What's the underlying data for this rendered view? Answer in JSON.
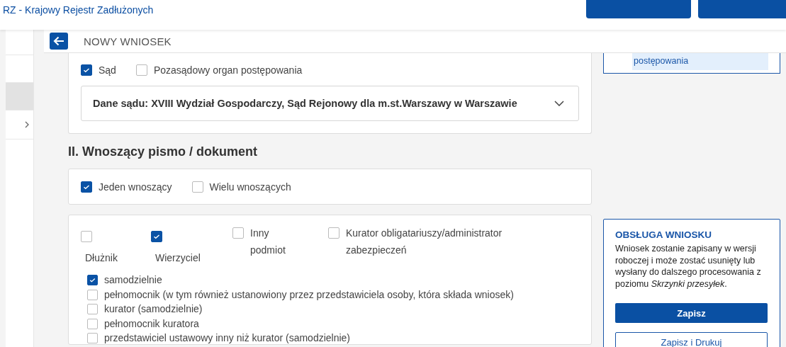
{
  "app_title": "RZ - Krajowy Rejestr Zadłużonych",
  "sidebar": {
    "items": [
      {
        "selected": false,
        "expandable": false
      },
      {
        "selected": true,
        "expandable": false
      },
      {
        "selected": false,
        "expandable": true
      }
    ]
  },
  "page_title": "NOWY WNIOSEK",
  "court_type_options": [
    {
      "label": "Sąd",
      "checked": true
    },
    {
      "label": "Pozasądowy organ postępowania",
      "checked": false
    }
  ],
  "court_select": {
    "value": "Dane sądu: XVIII Wydział Gospodarczy, Sąd Rejonowy dla m.st.Warszawy w Warszawie"
  },
  "section_heading": "II. Wnoszący pismo / dokument",
  "filer_count_options": [
    {
      "label": "Jeden wnoszący",
      "checked": true
    },
    {
      "label": "Wielu wnoszących",
      "checked": false
    }
  ],
  "filer_roles": [
    {
      "label": "Dłużnik",
      "checked": false
    },
    {
      "label": "Wierzyciel",
      "checked": true
    },
    {
      "label": "Inny podmiot",
      "checked": false
    },
    {
      "label": "Kurator obligatariuszy/administrator zabezpieczeń",
      "checked": false
    }
  ],
  "representation_options": [
    {
      "label": "samodzielnie",
      "checked": true
    },
    {
      "label": "pełnomocnik (w tym również ustanowiony przez przedstawiciela osoby, która składa wniosek)",
      "checked": false
    },
    {
      "label": "kurator (samodzielnie)",
      "checked": false
    },
    {
      "label": "pełnomocnik kuratora",
      "checked": false
    },
    {
      "label": "przedstawiciel ustawowy inny niż kurator (samodzielnie)",
      "checked": false
    }
  ],
  "side_panel_link": "postępowania",
  "request_panel": {
    "title": "OBSŁUGA WNIOSKU",
    "description": "Wniosek zostanie zapisany w wersji roboczej i może zostać usunięty lub wysłany do dalszego procesowania z poziomu *Skrzynki przesyłek*.",
    "buttons": [
      {
        "label": "Zapisz",
        "kind": "primary"
      },
      {
        "label": "Zapisz i Drukuj",
        "kind": "secondary"
      }
    ]
  }
}
